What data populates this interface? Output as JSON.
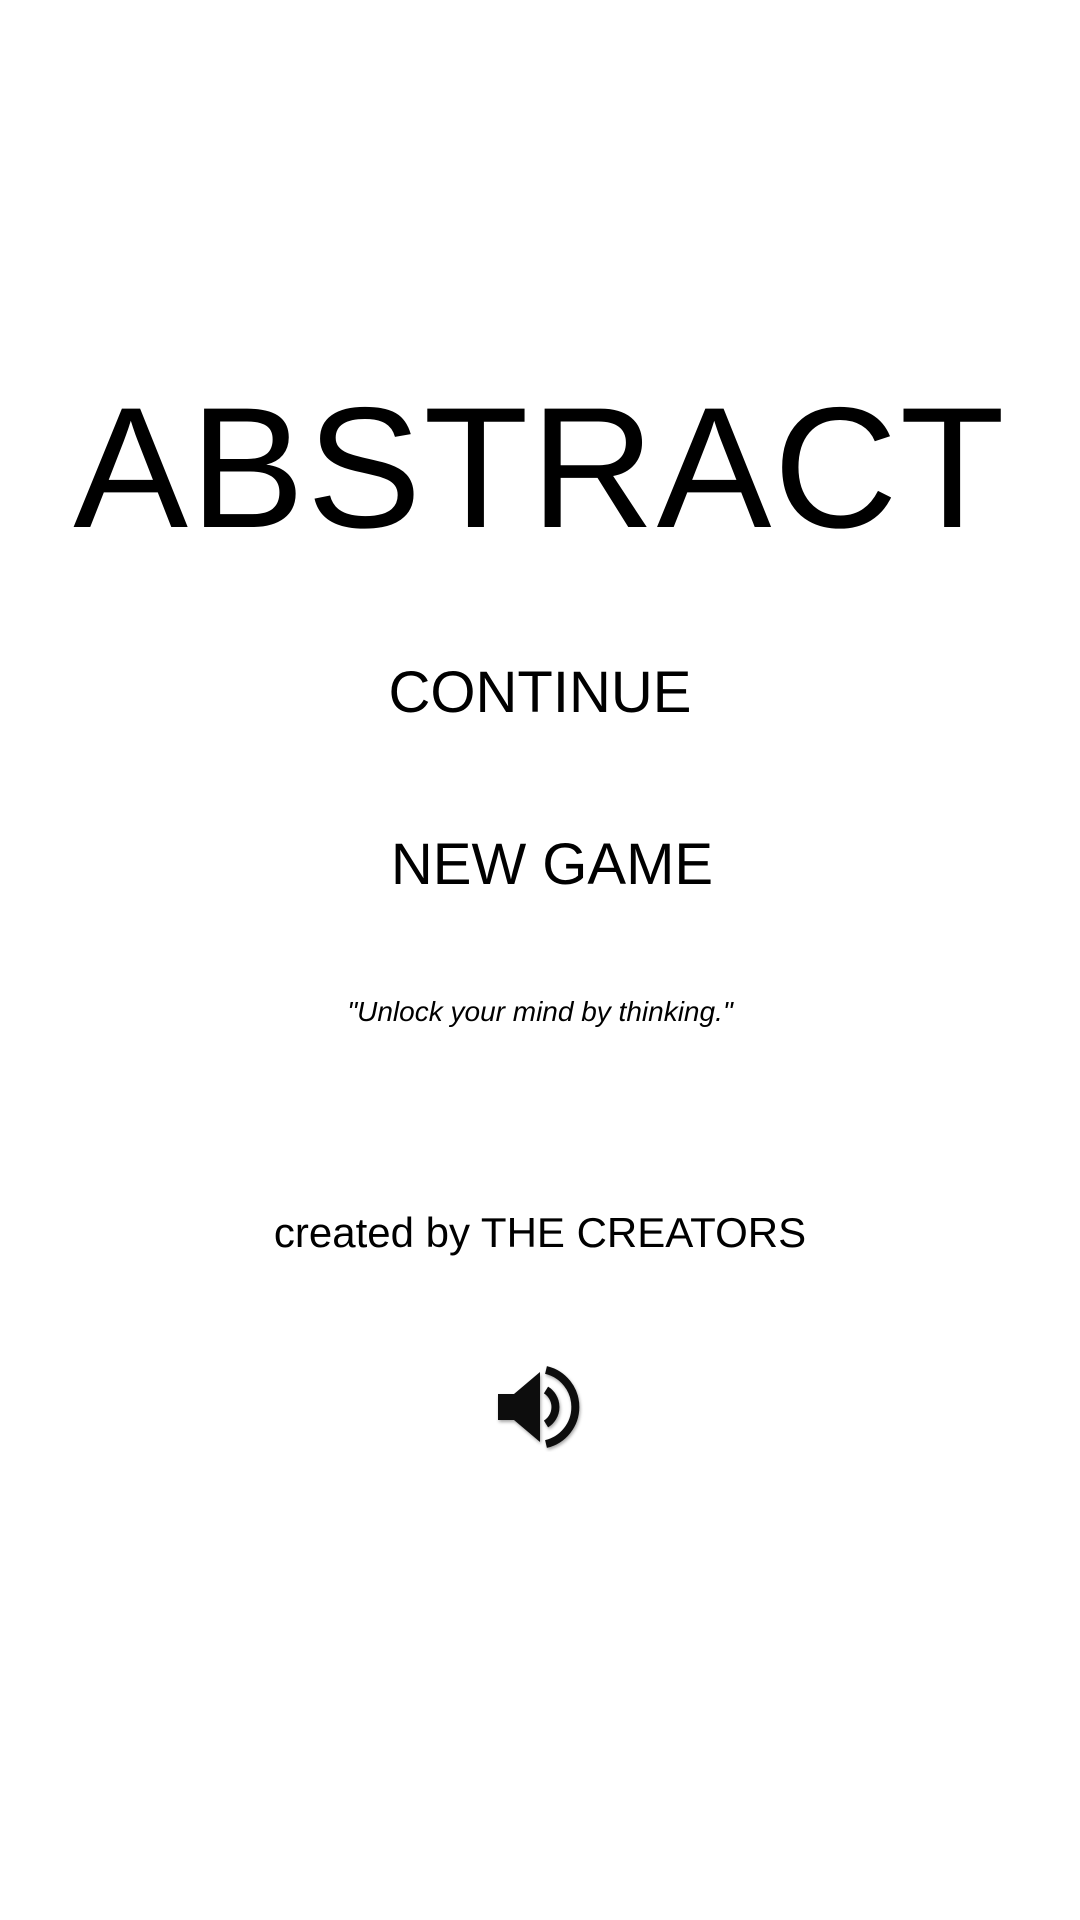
{
  "screen": "main-menu",
  "title": "ABSTRACT",
  "menu": {
    "continue_label": "CONTINUE",
    "new_game_label": "NEW GAME"
  },
  "tagline": "\"Unlock your mind by thinking.\"",
  "credits": "created by THE CREATORS",
  "sound": {
    "icon": "speaker-volume-icon",
    "state": "on"
  },
  "colors": {
    "background": "#ffffff",
    "text": "#000000"
  }
}
